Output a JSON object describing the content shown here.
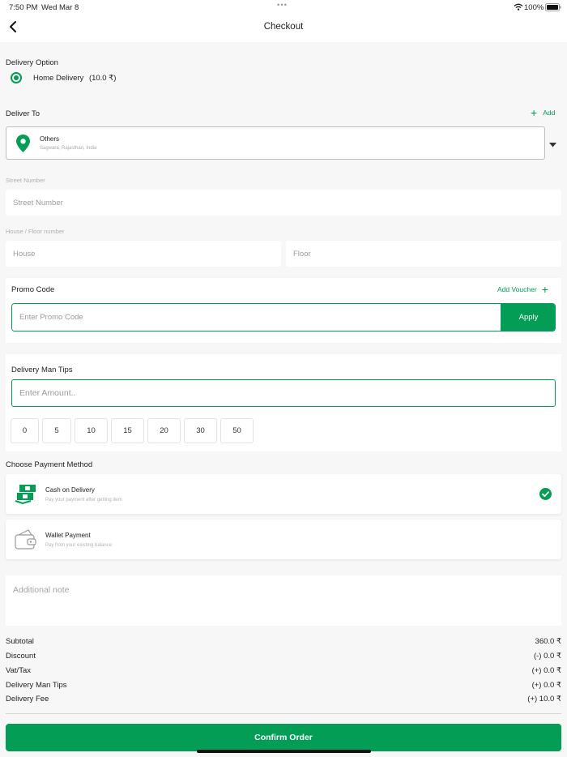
{
  "status": {
    "time": "7:50 PM",
    "date": "Wed Mar 8",
    "battery": "100%"
  },
  "header": {
    "title": "Checkout"
  },
  "delivery_option": {
    "title": "Delivery Option",
    "option_label": "Home Delivery",
    "option_price": "(10.0 ₹)"
  },
  "deliver_to": {
    "title": "Deliver To",
    "add_label": "Add",
    "address_type": "Others",
    "address_text": "Sagwara, Rajasthan, India",
    "street_label": "Street Number",
    "street_placeholder": "Street Number",
    "house_floor_label": "House / Floor number",
    "house_placeholder": "House",
    "floor_placeholder": "Floor"
  },
  "promo": {
    "title": "Promo Code",
    "add_voucher_label": "Add Voucher",
    "placeholder": "Enter Promo Code",
    "apply_label": "Apply"
  },
  "tips": {
    "title": "Delivery Man Tips",
    "placeholder": "Enter Amount..",
    "amounts": [
      "0",
      "5",
      "10",
      "15",
      "20",
      "30",
      "50"
    ]
  },
  "payment": {
    "title": "Choose Payment Method",
    "methods": [
      {
        "name": "Cash on Delivery",
        "desc": "Pay your payment after getting item",
        "selected": true
      },
      {
        "name": "Wallet Payment",
        "desc": "Pay from your existing balance",
        "selected": false
      }
    ]
  },
  "note": {
    "placeholder": "Additional note"
  },
  "summary": {
    "rows": [
      {
        "label": "Subtotal",
        "value": "360.0 ₹"
      },
      {
        "label": "Discount",
        "value": "(-) 0.0 ₹"
      },
      {
        "label": "Vat/Tax",
        "value": "(+) 0.0 ₹"
      },
      {
        "label": "Delivery Man Tips",
        "value": "(+) 0.0 ₹"
      },
      {
        "label": "Delivery Fee",
        "value": "(+) 10.0 ₹"
      }
    ]
  },
  "confirm_label": "Confirm Order",
  "colors": {
    "accent": "#039d55",
    "background": "#f7f7f7"
  }
}
